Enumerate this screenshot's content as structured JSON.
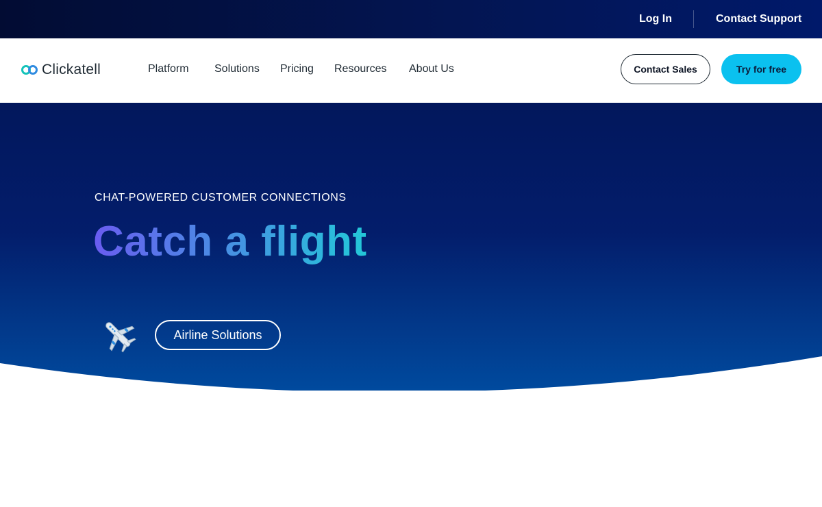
{
  "utility_bar": {
    "login": "Log In",
    "contact_support": "Contact Support"
  },
  "brand": {
    "name": "Clickatell",
    "logo_icon": "linked-rings-logo",
    "logo_colors": [
      "#14c3b9",
      "#2f8be0"
    ]
  },
  "nav": {
    "items": [
      {
        "label": "Platform"
      },
      {
        "label": "Solutions"
      },
      {
        "label": "Pricing"
      },
      {
        "label": "Resources"
      },
      {
        "label": "About Us"
      }
    ],
    "contact_sales": "Contact Sales",
    "try_free": "Try for free"
  },
  "hero": {
    "eyebrow": "CHAT-POWERED CUSTOMER CONNECTIONS",
    "title": "Catch a flight",
    "plane_icon": "airplane-icon",
    "cta": "Airline Solutions"
  },
  "colors": {
    "accent_cyan": "#0bc1ef",
    "hero_navy": "#02175c",
    "utility_navy": "#020c33",
    "title_gradient": [
      "#6a5cf0",
      "#4a8ce4",
      "#23c8d8"
    ]
  }
}
